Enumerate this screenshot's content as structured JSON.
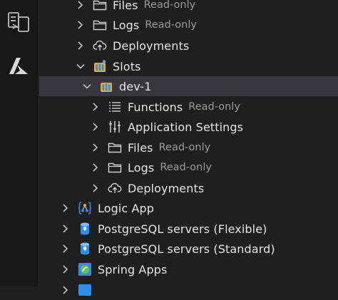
{
  "activity_bar": {
    "items": [
      {
        "icon": "remote-explorer-icon"
      },
      {
        "icon": "azure-icon"
      }
    ]
  },
  "tree": {
    "rows": [
      {
        "label": "Files",
        "description": "Read-only",
        "icon": "folder-icon",
        "chevron": "right"
      },
      {
        "label": "Logs",
        "description": "Read-only",
        "icon": "folder-icon",
        "chevron": "right"
      },
      {
        "label": "Deployments",
        "description": "",
        "icon": "cloud-upload-icon",
        "chevron": "right"
      },
      {
        "label": "Slots",
        "description": "",
        "icon": "slots-icon",
        "chevron": "down"
      },
      {
        "label": "dev-1",
        "description": "",
        "icon": "slot-icon",
        "chevron": "down",
        "selected": true
      },
      {
        "label": "Functions",
        "description": "Read-only",
        "icon": "list-icon",
        "chevron": "right"
      },
      {
        "label": "Application Settings",
        "description": "",
        "icon": "settings-sliders-icon",
        "chevron": "right"
      },
      {
        "label": "Files",
        "description": "Read-only",
        "icon": "folder-icon",
        "chevron": "right"
      },
      {
        "label": "Logs",
        "description": "Read-only",
        "icon": "folder-icon",
        "chevron": "right"
      },
      {
        "label": "Deployments",
        "description": "",
        "icon": "cloud-upload-icon",
        "chevron": "right"
      },
      {
        "label": "Logic App",
        "description": "",
        "icon": "logic-app-icon",
        "chevron": "right"
      },
      {
        "label": "PostgreSQL servers (Flexible)",
        "description": "",
        "icon": "postgresql-icon",
        "chevron": "right"
      },
      {
        "label": "PostgreSQL servers (Standard)",
        "description": "",
        "icon": "postgresql-icon",
        "chevron": "right"
      },
      {
        "label": "Spring Apps",
        "description": "",
        "icon": "spring-apps-icon",
        "chevron": "right"
      }
    ]
  },
  "colors": {
    "background": "#1f1f1f",
    "activity_bar": "#181818",
    "selected_row": "#37373d",
    "label": "#e6e6e6",
    "description": "#9a9a9a",
    "azure_blue": "#2f8fe8",
    "slots_gold": "#f2a52e"
  }
}
